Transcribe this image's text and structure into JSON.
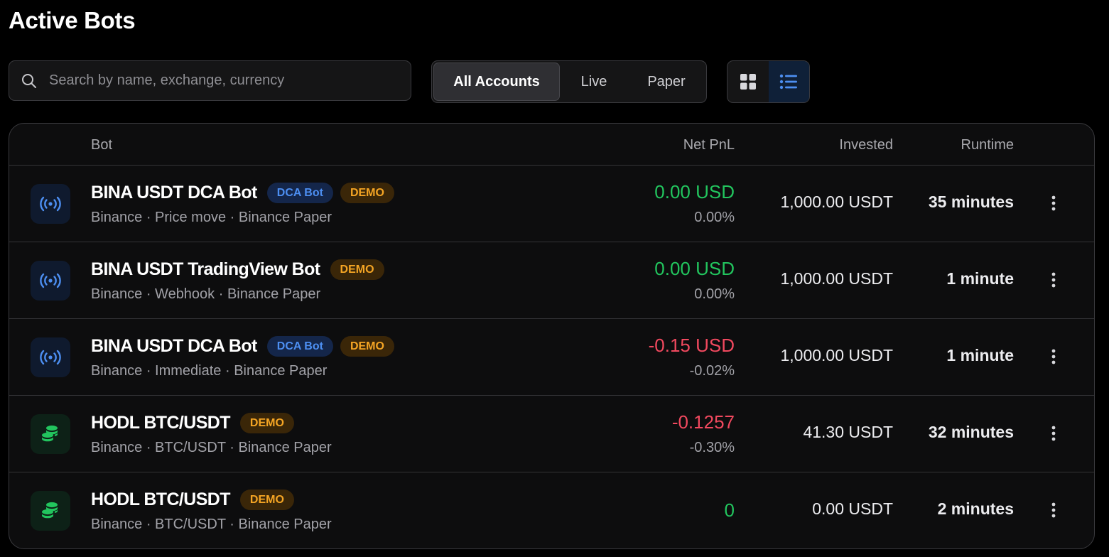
{
  "page": {
    "title": "Active Bots"
  },
  "search": {
    "placeholder": "Search by name, exchange, currency",
    "value": ""
  },
  "account_filter": {
    "options": [
      {
        "label": "All Accounts",
        "active": true
      },
      {
        "label": "Live",
        "active": false
      },
      {
        "label": "Paper",
        "active": false
      }
    ]
  },
  "view_toggle": {
    "grid_icon": "grid-icon",
    "list_icon": "list-icon",
    "active": "list"
  },
  "table": {
    "headers": {
      "bot": "Bot",
      "pnl": "Net PnL",
      "invested": "Invested",
      "runtime": "Runtime"
    },
    "rows": [
      {
        "icon": "broadcast-icon",
        "name": "BINA USDT DCA Bot",
        "type_badge": "DCA Bot",
        "demo_badge": "DEMO",
        "subtitle": "Binance · Price move · Binance Paper",
        "pnl": "0.00 USD",
        "pnl_pct": "0.00%",
        "pnl_trend": "positive",
        "invested": "1,000.00 USDT",
        "runtime": "35 minutes"
      },
      {
        "icon": "broadcast-icon",
        "name": "BINA USDT TradingView Bot",
        "type_badge": "",
        "demo_badge": "DEMO",
        "subtitle": "Binance · Webhook · Binance Paper",
        "pnl": "0.00 USD",
        "pnl_pct": "0.00%",
        "pnl_trend": "positive",
        "invested": "1,000.00 USDT",
        "runtime": "1 minute"
      },
      {
        "icon": "broadcast-icon",
        "name": "BINA USDT DCA Bot",
        "type_badge": "DCA Bot",
        "demo_badge": "DEMO",
        "subtitle": "Binance · Immediate · Binance Paper",
        "pnl": "-0.15 USD",
        "pnl_pct": "-0.02%",
        "pnl_trend": "negative",
        "invested": "1,000.00 USDT",
        "runtime": "1 minute"
      },
      {
        "icon": "coins-icon",
        "name": "HODL BTC/USDT",
        "type_badge": "",
        "demo_badge": "DEMO",
        "subtitle": "Binance · BTC/USDT · Binance Paper",
        "pnl": "-0.1257",
        "pnl_pct": "-0.30%",
        "pnl_trend": "negative",
        "invested": "41.30 USDT",
        "runtime": "32 minutes"
      },
      {
        "icon": "coins-icon",
        "name": "HODL BTC/USDT",
        "type_badge": "",
        "demo_badge": "DEMO",
        "subtitle": "Binance · BTC/USDT · Binance Paper",
        "pnl": "0",
        "pnl_pct": "",
        "pnl_trend": "positive",
        "invested": "0.00 USDT",
        "runtime": "2 minutes"
      }
    ]
  },
  "colors": {
    "positive": "#22c55e",
    "negative": "#f2495f",
    "accent": "#4d8ff2",
    "demo": "#f5a524"
  }
}
